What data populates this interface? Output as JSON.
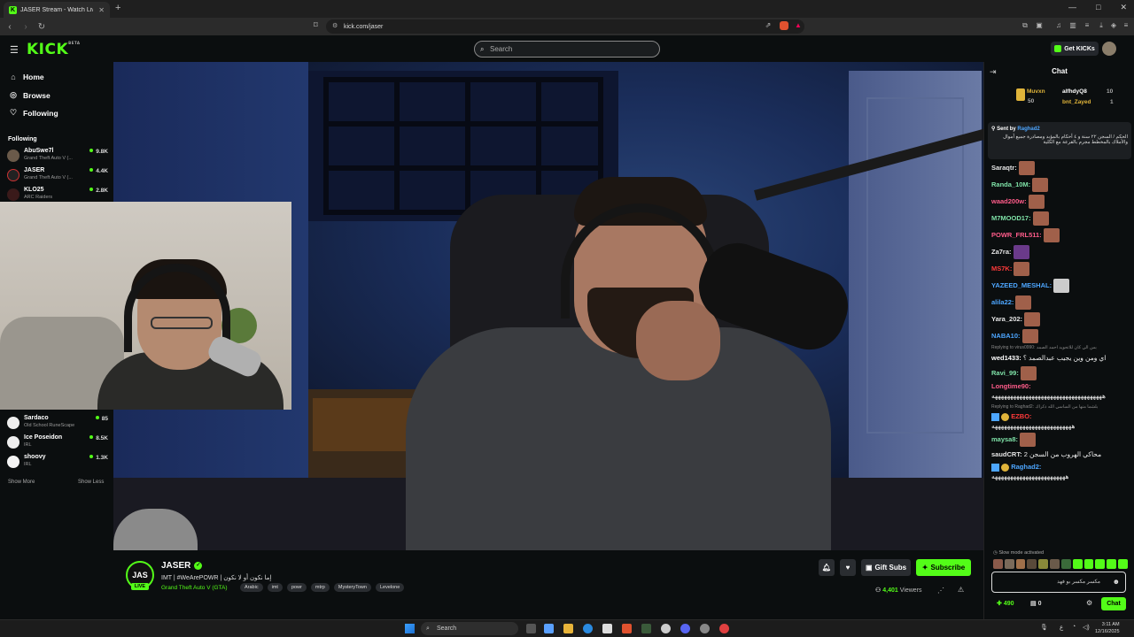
{
  "browser": {
    "tab_title": "JASER Stream - Watch Live on",
    "url": "kick.com/jaser",
    "win_controls": [
      "—",
      "□",
      "✕"
    ]
  },
  "header": {
    "logo": "KICK",
    "logo_sup": "BETA",
    "search_placeholder": "Search",
    "get_kicks": "Get KICKs"
  },
  "sidebar": {
    "nav": [
      {
        "label": "Home",
        "icon": "home-icon"
      },
      {
        "label": "Browse",
        "icon": "compass-icon"
      },
      {
        "label": "Following",
        "icon": "heart-icon"
      }
    ],
    "following_heading": "Following",
    "following": [
      {
        "name": "AbuSwe7l",
        "game": "Grand Theft Auto V (...",
        "count": "9.8K"
      },
      {
        "name": "JASER",
        "game": "Grand Theft Auto V (...",
        "count": "4.4K"
      },
      {
        "name": "KLO25",
        "game": "ARC Raiders",
        "count": "2.8K"
      }
    ],
    "following_lower": [
      {
        "name": "Sardaco",
        "game": "Old School RuneScape",
        "count": "85"
      },
      {
        "name": "Ice Poseidon",
        "game": "IRL",
        "count": "8.5K"
      },
      {
        "name": "shoovy",
        "game": "IRL",
        "count": "1.3K"
      }
    ],
    "show_more": "Show More",
    "show_less": "Show Less"
  },
  "stream": {
    "channel": "JASER",
    "avatar_text": "JAS",
    "live_badge": "LIVE",
    "title": "IMT | #WeArePOWR | إما نكون أو لا نكون",
    "category": "Grand Theft Auto V (GTA)",
    "tags": [
      "Arabic",
      "imt",
      "powr",
      "mtrp",
      "MysteryTown",
      "Levelone"
    ],
    "gift_subs": "Gift Subs",
    "subscribe": "Subscribe",
    "viewers_count": "4,401",
    "viewers_label": "Viewers"
  },
  "chat": {
    "title": "Chat",
    "gifters": [
      {
        "name": "Muvxn",
        "count": "50"
      },
      {
        "name": "alfhdyQ8",
        "count": "10"
      },
      {
        "name": "bnt_Zayed",
        "count": "1"
      }
    ],
    "pinned_header": "Sent by",
    "pinned_user": "Raghad2",
    "pinned_text": "الحكم / السجن ٢٢ سنة و ٤ أحكام بالمؤبد ومصادرة جميع أموال والأملاك بالمخطط مجرم بالقرعة مع الكلية",
    "messages": [
      {
        "user": "Saraqtr:",
        "color": "#e6e6e6",
        "text": "",
        "emote": true
      },
      {
        "user": "Randa_10M:",
        "color": "#7fe3a8",
        "text": "",
        "emote": true
      },
      {
        "user": "waad200w:",
        "color": "#ff5c8a",
        "text": "",
        "emote": true
      },
      {
        "user": "M7MOOD17:",
        "color": "#7fe3a8",
        "text": "",
        "emote": true
      },
      {
        "user": "POWR_FRL511:",
        "color": "#ff5c8a",
        "text": "",
        "emote": true
      },
      {
        "user": "Za7ra:",
        "color": "#e6e6e6",
        "text": "",
        "emote": true
      },
      {
        "user": "MS7K:",
        "color": "#ff3a3a",
        "text": "",
        "emote": true
      },
      {
        "user": "YAZEED_MESHAL:",
        "color": "#4da6ff",
        "text": "",
        "emote": true
      },
      {
        "user": "alila22:",
        "color": "#4da6ff",
        "text": "",
        "emote": true
      },
      {
        "user": "Yara_202:",
        "color": "#e6e6e6",
        "text": "",
        "emote": true
      },
      {
        "user": "NABA10:",
        "color": "#4da6ff",
        "text": "",
        "emote": true
      }
    ],
    "reply1": "Replying to virus0990: بس الي كان للاتحويد احمد الصمد",
    "msg_wed": {
      "user": "wed1433:",
      "text": "اي ومن وين يجيب عبدالصمد ؟"
    },
    "msg_ravi": {
      "user": "Ravi_99:"
    },
    "msg_long": {
      "user": "Longtime90:",
      "text": "ههههههههههههههههههههههههههههههههههههه"
    },
    "reply2": "Replying to Raghad2: بلشما منها من الساسي الله ذكراك",
    "msg_ezbo": {
      "user": "EZBO:",
      "text": "ههههههههههههههههههههههههههه"
    },
    "msg_maysa": {
      "user": "maysa8:"
    },
    "msg_saud": {
      "user": "saudCRT:",
      "text": "محاكي الهروب من السجن 2"
    },
    "msg_raghad": {
      "user": "Raghad2:",
      "text": "ههههههههههههههههههههههههه"
    },
    "slow_mode": "Slow mode activated",
    "input_value": "مكسر مكسر بو فهد",
    "kicks_count": "490",
    "other_count": "0",
    "chat_button": "Chat"
  },
  "taskbar": {
    "search": "Search",
    "time": "3:11 AM",
    "date": "12/16/2025",
    "lang": "ع"
  },
  "colors": {
    "accent": "#53fc18",
    "background": "#0b0e0f"
  }
}
